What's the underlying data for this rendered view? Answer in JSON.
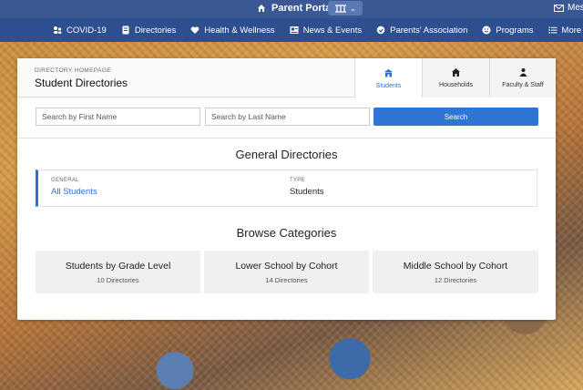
{
  "top_bar": {
    "portal_title": "Parent Portal",
    "messages_label": "Mes"
  },
  "nav": {
    "items": [
      {
        "label": "COVID-19",
        "icon": "people-icon"
      },
      {
        "label": "Directories",
        "icon": "directory-icon"
      },
      {
        "label": "Health & Wellness",
        "icon": "heart-icon"
      },
      {
        "label": "News & Events",
        "icon": "news-icon"
      },
      {
        "label": "Parents' Association",
        "icon": "hands-icon"
      },
      {
        "label": "Programs",
        "icon": "smile-icon"
      },
      {
        "label": "More",
        "icon": "list-icon"
      }
    ]
  },
  "header": {
    "eyebrow": "DIRECTORY HOMEPAGE",
    "title": "Student Directories",
    "tabs": [
      {
        "label": "Students",
        "active": true
      },
      {
        "label": "Households",
        "active": false
      },
      {
        "label": "Faculty & Staff",
        "active": false
      }
    ]
  },
  "search": {
    "first_placeholder": "Search by First Name",
    "last_placeholder": "Search by Last Name",
    "button_label": "Search"
  },
  "general": {
    "title": "General Directories",
    "col_general_label": "GENERAL",
    "col_type_label": "TYPE",
    "rows": [
      {
        "name": "All Students",
        "type": "Students"
      }
    ]
  },
  "browse": {
    "title": "Browse Categories",
    "categories": [
      {
        "name": "Students by Grade Level",
        "count": "10 Directories"
      },
      {
        "name": "Lower School by Cohort",
        "count": "14 Directories"
      },
      {
        "name": "Middle School by Cohort",
        "count": "12 Directories"
      }
    ]
  },
  "colors": {
    "accent": "#2f6fd0",
    "nav_bg": "#2e4f8f",
    "top_bar_bg": "#3a5894"
  }
}
